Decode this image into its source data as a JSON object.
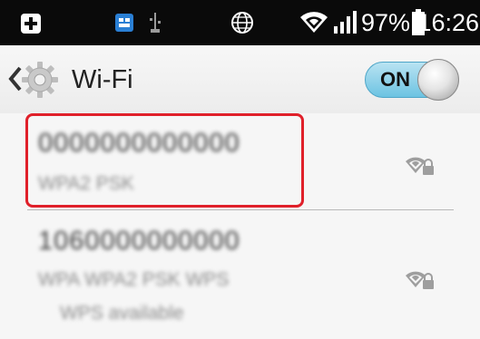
{
  "status_bar": {
    "icons": [
      "notification-icon",
      "sim-icon",
      "usb-icon",
      "globe-icon",
      "wifi-icon",
      "signal-icon",
      "battery-icon"
    ],
    "battery_percent": "97%",
    "time": "16:26"
  },
  "action_bar": {
    "title": "Wi-Fi",
    "toggle_label": "ON"
  },
  "networks": [
    {
      "ssid": "0000000000000",
      "subtitle": "WPA2 PSK",
      "secured": true,
      "highlighted": true
    },
    {
      "ssid": "1060000000000",
      "subtitle": "WPA WPA2 PSK WPS",
      "subtitle_line2": "WPS available",
      "secured": true,
      "highlighted": false
    }
  ],
  "colors": {
    "status_bar_bg": "#0a0a0a",
    "highlight_border": "#e0202a",
    "toggle_on": "#6cc3e2"
  }
}
